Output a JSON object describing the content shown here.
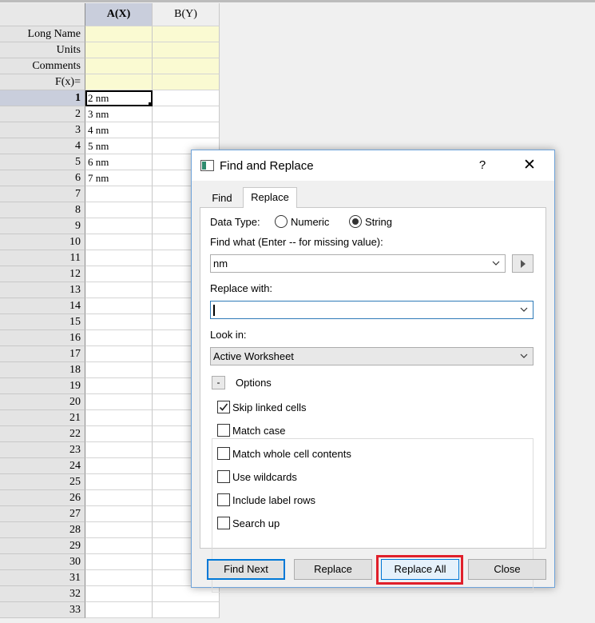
{
  "worksheet": {
    "columns": [
      "A(X)",
      "B(Y)"
    ],
    "label_rows": [
      "Long Name",
      "Units",
      "Comments",
      "F(x)="
    ],
    "rows": [
      {
        "n": "1",
        "a": "2 nm"
      },
      {
        "n": "2",
        "a": "3 nm"
      },
      {
        "n": "3",
        "a": "4 nm"
      },
      {
        "n": "4",
        "a": "5 nm"
      },
      {
        "n": "5",
        "a": "6 nm"
      },
      {
        "n": "6",
        "a": "7 nm"
      },
      {
        "n": "7",
        "a": ""
      },
      {
        "n": "8",
        "a": ""
      },
      {
        "n": "9",
        "a": ""
      },
      {
        "n": "10",
        "a": ""
      },
      {
        "n": "11",
        "a": ""
      },
      {
        "n": "12",
        "a": ""
      },
      {
        "n": "13",
        "a": ""
      },
      {
        "n": "14",
        "a": ""
      },
      {
        "n": "15",
        "a": ""
      },
      {
        "n": "16",
        "a": ""
      },
      {
        "n": "17",
        "a": ""
      },
      {
        "n": "18",
        "a": ""
      },
      {
        "n": "19",
        "a": ""
      },
      {
        "n": "20",
        "a": ""
      },
      {
        "n": "21",
        "a": ""
      },
      {
        "n": "22",
        "a": ""
      },
      {
        "n": "23",
        "a": ""
      },
      {
        "n": "24",
        "a": ""
      },
      {
        "n": "25",
        "a": ""
      },
      {
        "n": "26",
        "a": ""
      },
      {
        "n": "27",
        "a": ""
      },
      {
        "n": "28",
        "a": ""
      },
      {
        "n": "29",
        "a": ""
      },
      {
        "n": "30",
        "a": ""
      },
      {
        "n": "31",
        "a": ""
      },
      {
        "n": "32",
        "a": ""
      },
      {
        "n": "33",
        "a": ""
      }
    ]
  },
  "dialog": {
    "title": "Find and Replace",
    "help": "?",
    "close_glyph": "✕",
    "tabs": [
      "Find",
      "Replace"
    ],
    "active_tab": "Replace",
    "data_type_label": "Data Type:",
    "radio_numeric": "Numeric",
    "radio_string": "String",
    "selected_type": "String",
    "find_label": "Find what (Enter -- for missing value):",
    "find_value": "nm",
    "replace_label": "Replace with:",
    "replace_value": "",
    "look_in_label": "Look in:",
    "look_in_value": "Active Worksheet",
    "options_toggle": "-",
    "options_label": "Options",
    "options": [
      {
        "label": "Skip linked cells",
        "checked": true
      },
      {
        "label": "Match case",
        "checked": false
      },
      {
        "label": "Match whole cell contents",
        "checked": false
      },
      {
        "label": "Use wildcards",
        "checked": false
      },
      {
        "label": "Include label rows",
        "checked": false
      },
      {
        "label": "Search up",
        "checked": false
      }
    ],
    "buttons": {
      "find_next": "Find Next",
      "replace": "Replace",
      "replace_all": "Replace All",
      "close": "Close"
    },
    "highlight_color": "#e0202b"
  }
}
